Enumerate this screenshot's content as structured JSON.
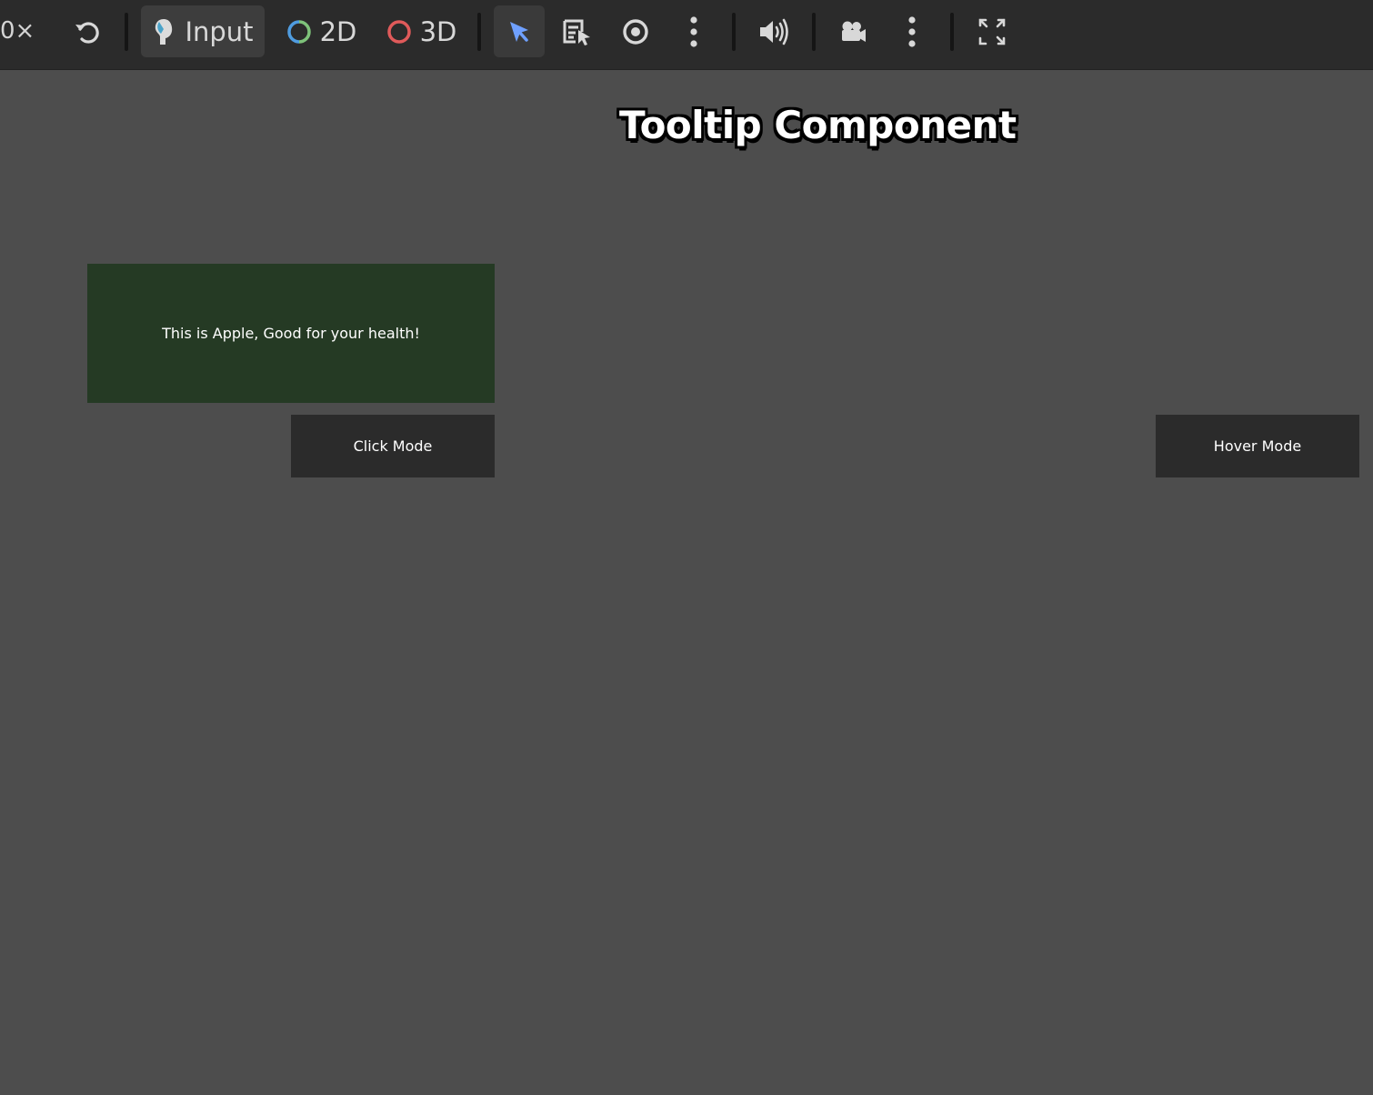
{
  "toolbar": {
    "speed_label": "0×",
    "modes": [
      {
        "label": "Input",
        "icon": "input-icon"
      },
      {
        "label": "2D",
        "icon": "2d-ring-icon"
      },
      {
        "label": "3D",
        "icon": "3d-ring-icon"
      }
    ],
    "active_mode": "Input",
    "icons": [
      "reset-icon",
      "select-cursor-icon",
      "list-select-icon",
      "eye-icon",
      "more-vertical-icon",
      "speaker-icon",
      "camera-icon",
      "more-vertical-icon",
      "fullscreen-icon"
    ],
    "colors": {
      "ring_2d": [
        "#4f9ce0",
        "#7ec27a"
      ],
      "ring_3d": "#e05a5a",
      "select_cursor": "#6fa0ff"
    }
  },
  "main": {
    "title": "Tooltip Component",
    "tooltip_text": "This is Apple, Good for your health!",
    "click_mode_label": "Click Mode",
    "hover_mode_label": "Hover Mode",
    "tooltip_color": "#253a24"
  }
}
